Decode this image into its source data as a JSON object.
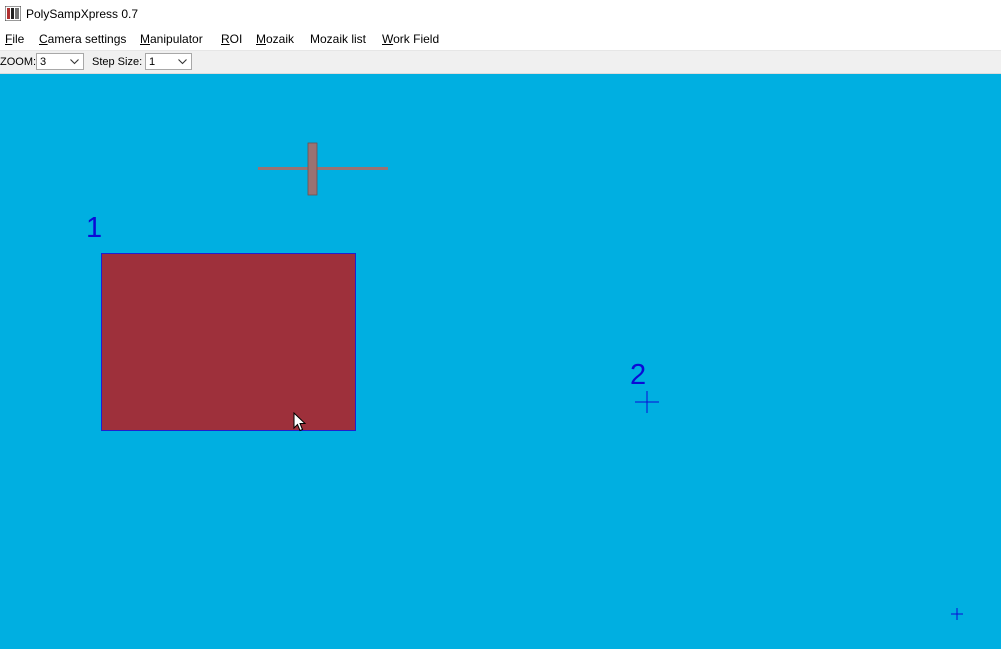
{
  "window": {
    "title": "PolySampXpress 0.7",
    "icon": "app-logo-icon"
  },
  "menu": {
    "items": [
      {
        "label": "File",
        "mnemonic": "F",
        "rest": "ile"
      },
      {
        "label": "Camera settings",
        "mnemonic": "C",
        "rest": "amera settings"
      },
      {
        "label": "Manipulator",
        "mnemonic": "M",
        "rest": "anipulator"
      },
      {
        "label": "ROI",
        "mnemonic": "R",
        "rest": "OI"
      },
      {
        "label": "Mozaik",
        "mnemonic": "M",
        "rest": "ozaik"
      },
      {
        "label": "Mozaik list",
        "mnemonic": "",
        "rest": "Mozaik list"
      },
      {
        "label": "Work Field",
        "mnemonic": "W",
        "rest": "ork Field"
      }
    ]
  },
  "toolbar": {
    "zoom_label": "ZOOM:",
    "zoom_value": "3",
    "step_label": "Step Size:",
    "step_value": "1"
  },
  "canvas": {
    "background": "#00afe1",
    "roi_labels": [
      "1",
      "2"
    ],
    "roi_rect_fill": "#9e303b",
    "roi_rect_border": "#2020d0",
    "marker_color": "#0b0bd6",
    "manipulator_color": "#9a7272"
  }
}
